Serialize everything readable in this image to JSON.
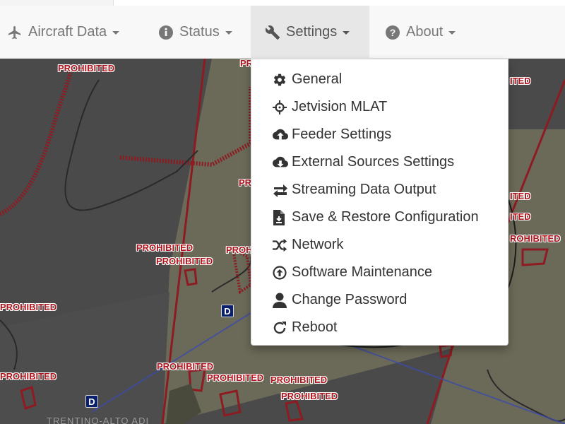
{
  "navbar": {
    "items": [
      {
        "label": "Aircraft Data",
        "icon": "airplane-icon"
      },
      {
        "label": "Status",
        "icon": "info-circle-icon"
      },
      {
        "label": "Settings",
        "icon": "wrench-icon",
        "active": true
      },
      {
        "label": "About",
        "icon": "question-circle-icon"
      }
    ]
  },
  "settings_menu": {
    "items": [
      {
        "label": "General",
        "icon": "gear-icon"
      },
      {
        "label": "Jetvision MLAT",
        "icon": "crosshair-icon"
      },
      {
        "label": "Feeder Settings",
        "icon": "cloud-upload-icon"
      },
      {
        "label": "External Sources Settings",
        "icon": "cloud-download-icon"
      },
      {
        "label": "Streaming Data Output",
        "icon": "transfer-arrows-icon"
      },
      {
        "label": "Save & Restore Configuration",
        "icon": "file-import-icon"
      },
      {
        "label": "Network",
        "icon": "shuffle-icon"
      },
      {
        "label": "Software Maintenance",
        "icon": "circle-arrow-up-icon"
      },
      {
        "label": "Change Password",
        "icon": "user-icon"
      },
      {
        "label": "Reboot",
        "icon": "refresh-icon"
      }
    ]
  },
  "map": {
    "prohibited_label": "PROHIBITED",
    "partial_labels": [
      "PR",
      "PR",
      "PROH",
      "ITED",
      "ITED",
      "ITED",
      "ROHIBITED",
      "IITED",
      "PROHIBITED"
    ],
    "marker_letter": "D",
    "place_label": "TRENTINO-ALTO ADI",
    "colors": {
      "background": "#4a4a4a",
      "airspace_fill": "#6b6a58",
      "airspace_border": "#8e1b22",
      "boundary_line": "#2a2a2a",
      "route_line": "#3d4ba8"
    }
  }
}
